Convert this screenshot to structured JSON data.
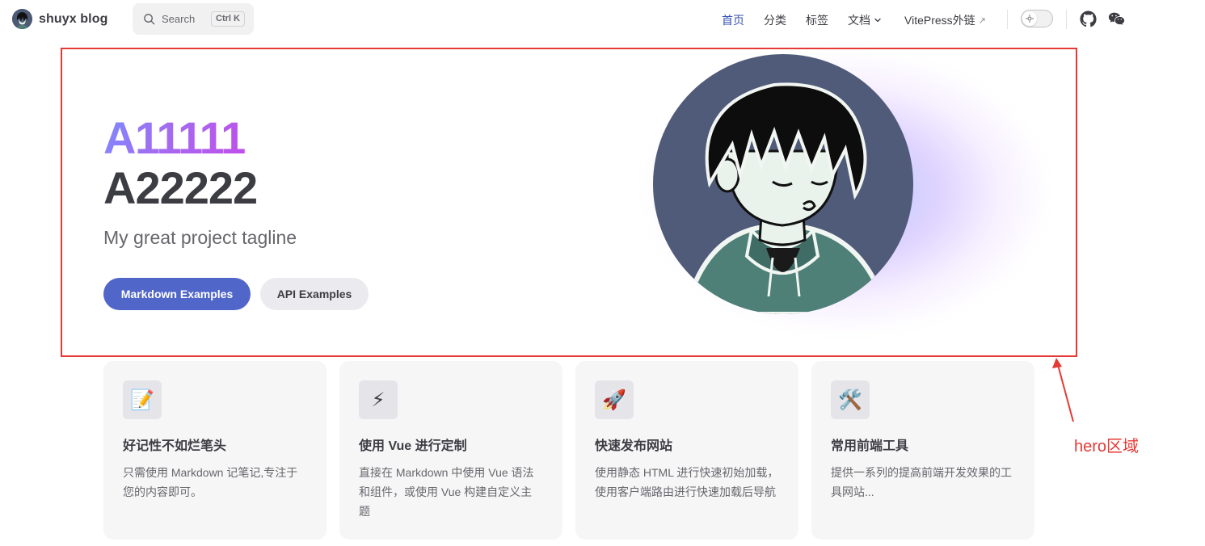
{
  "nav": {
    "site_title": "shuyx blog",
    "search": {
      "label": "Search",
      "kbd": "Ctrl K"
    },
    "menu": [
      {
        "label": "首页",
        "active": true
      },
      {
        "label": "分类"
      },
      {
        "label": "标签"
      },
      {
        "label": "文档",
        "dropdown": true
      },
      {
        "label": "VitePress外链",
        "external": true
      }
    ],
    "external_glyph": "↗",
    "social": [
      "github-icon",
      "wechat-icon"
    ],
    "accent_color": "#3451b2"
  },
  "hero": {
    "name": "A11111",
    "text": "A22222",
    "tagline": "My great project tagline",
    "actions": [
      {
        "label": "Markdown Examples",
        "theme": "brand"
      },
      {
        "label": "API Examples",
        "theme": "alt"
      }
    ],
    "brand_color": "#5066c9"
  },
  "features": [
    {
      "icon": "📝",
      "title": "好记性不如烂笔头",
      "details": "只需使用 Markdown 记笔记,专注于您的内容即可。"
    },
    {
      "icon": "⚡",
      "title": "使用 Vue 进行定制",
      "details": "直接在 Markdown 中使用 Vue 语法和组件，或使用 Vue 构建自定义主题"
    },
    {
      "icon": "🚀",
      "title": "快速发布网站",
      "details": "使用静态 HTML 进行快速初始加载，使用客户端路由进行快速加载后导航"
    },
    {
      "icon": "🛠️",
      "title": "常用前端工具",
      "details": "提供一系列的提高前端开发效果的工具网站..."
    }
  ],
  "annotation": {
    "label": "hero区域",
    "color": "#e53935"
  }
}
